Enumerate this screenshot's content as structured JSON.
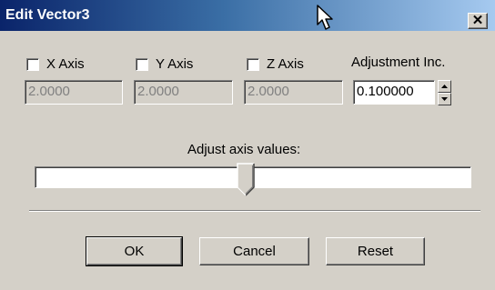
{
  "window": {
    "title": "Edit Vector3",
    "close_icon": "close-icon"
  },
  "axes": [
    {
      "label": "X Axis",
      "checked": false,
      "value": "2.0000"
    },
    {
      "label": "Y Axis",
      "checked": false,
      "value": "2.0000"
    },
    {
      "label": "Z Axis",
      "checked": false,
      "value": "2.0000"
    }
  ],
  "adjustment": {
    "label": "Adjustment Inc.",
    "value": "0.100000"
  },
  "slider": {
    "label": "Adjust axis values:",
    "position_fraction": 0.5
  },
  "buttons": {
    "ok": "OK",
    "cancel": "Cancel",
    "reset": "Reset"
  },
  "colors": {
    "face": "#d4d0c8",
    "title_start": "#0a246a",
    "title_end": "#a6caf0",
    "disabled_text": "#808080"
  }
}
